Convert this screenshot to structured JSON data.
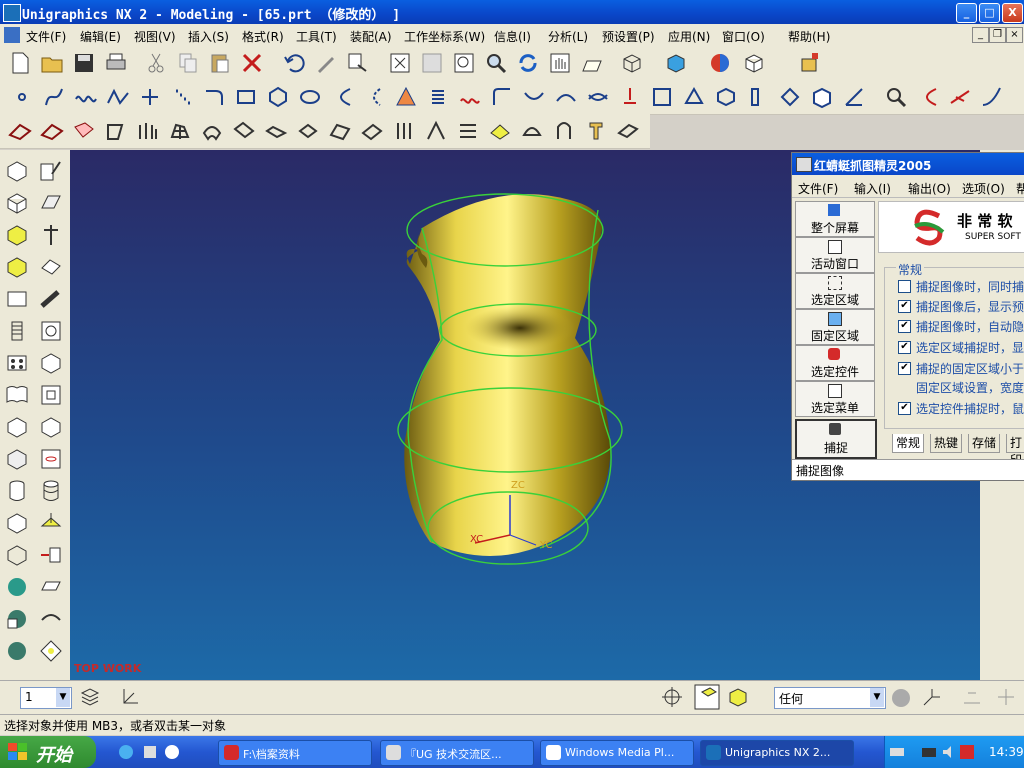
{
  "window": {
    "title": "Unigraphics NX 2 - Modeling - [65.prt （修改的） ]",
    "minimize": "_",
    "maximize": "□",
    "close": "X"
  },
  "menu": [
    "文件(F)",
    "编辑(E)",
    "视图(V)",
    "插入(S)",
    "格式(R)",
    "工具(T)",
    "装配(A)",
    "工作坐标系(W)",
    "信息(I)",
    "分析(L)",
    "预设置(P)",
    "应用(N)",
    "窗口(O)",
    "帮助(H)"
  ],
  "viewport": {
    "view_label": "TOP WORK",
    "axis_z": "ZC",
    "axis_x": "XC",
    "axis_y": "YC"
  },
  "bottom": {
    "layer_value": "1",
    "filter_value": "任何"
  },
  "status": "选择对象并使用 MB3，或者双击某一对象",
  "capture": {
    "title": "红蜻蜓抓图精灵2005",
    "menu": [
      "文件(F)",
      "输入(I)",
      "输出(O)",
      "选项(O)",
      "帮"
    ],
    "modes": [
      "整个屏幕",
      "活动窗口",
      "选定区域",
      "固定区域",
      "选定控件",
      "选定菜单"
    ],
    "capture_button": "捕捉",
    "brand": "非 常 软",
    "brand_sub": "SUPER SOFT",
    "group_label": "常规",
    "options": [
      {
        "text": "捕捉图像时，同时捕",
        "checked": false
      },
      {
        "text": "捕捉图像后，显示预",
        "checked": true
      },
      {
        "text": "捕捉图像时，自动隐",
        "checked": true
      },
      {
        "text": "选定区域捕捉时，显",
        "checked": true
      },
      {
        "text": "捕捉的固定区域小于",
        "checked": true
      },
      {
        "text": "固定区域设置，宽度",
        "checked": false
      },
      {
        "text": "选定控件捕捉时，鼠",
        "checked": true
      }
    ],
    "tabs": [
      "常规",
      "热键",
      "存储",
      "打印"
    ],
    "status": "捕捉图像"
  },
  "taskbar": {
    "start": "开始",
    "tasks": [
      "F:\\档案资料",
      "『UG 技术交流区...",
      "Windows Media Pl...",
      "Unigraphics NX 2..."
    ],
    "clock": "14:39"
  }
}
